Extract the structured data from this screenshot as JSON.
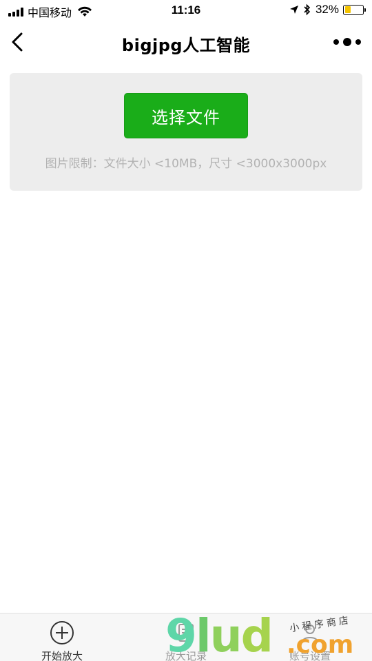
{
  "status_bar": {
    "carrier": "中国移动",
    "time": "11:16",
    "battery_percent": "32%",
    "battery_level": 0.32,
    "icons": [
      "signal-icon",
      "wifi-icon",
      "location-icon",
      "bluetooth-icon",
      "battery-icon"
    ]
  },
  "nav": {
    "title": "bigjpg人工智能",
    "back_icon": "chevron-left-icon",
    "more_icon": "more-dots-icon"
  },
  "upload": {
    "button_label": "选择文件",
    "limit_text": "图片限制：文件大小 <10MB，尺寸 <3000x3000px"
  },
  "tabs": [
    {
      "label": "开始放大",
      "icon": "plus-circle-icon",
      "active": true
    },
    {
      "label": "放大记录",
      "icon": "record-icon",
      "active": false
    },
    {
      "label": "账号设置",
      "icon": "user-icon",
      "active": false
    }
  ],
  "watermark": {
    "g": "9",
    "l": "l",
    "u": "u",
    "d": "d",
    "com": ".com",
    "sub": "小程序商店"
  },
  "colors": {
    "accent_green": "#1aad19",
    "card_bg": "#ededed",
    "hint_text": "#b2b2b2",
    "battery_fill": "#f5c400"
  }
}
